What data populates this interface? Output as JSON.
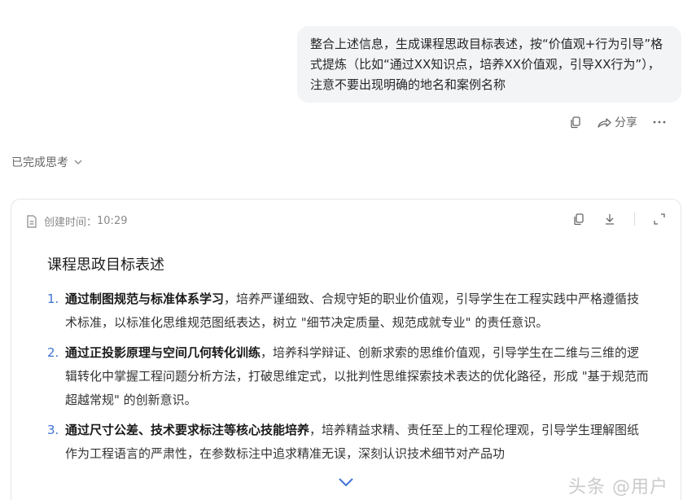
{
  "user_message": {
    "text": "整合上述信息，生成课程思政目标表述，按“价值观+行为引导”格式提炼（比如“通过XX知识点，培养XX价值观，引导XX行为”），注意不要出现明确的地名和案例名称"
  },
  "message_actions": {
    "copy_icon": "copy-icon",
    "share_label": "分享",
    "more_icon": "more-icon"
  },
  "thought": {
    "label": "已完成思考"
  },
  "document": {
    "created_label": "创建时间：",
    "created_time": "10:29",
    "title": "课程思政目标表述",
    "items": [
      {
        "num": "1.",
        "bold": "通过制图规范与标准体系学习",
        "text": "，培养严谨细致、合规守矩的职业价值观，引导学生在工程实践中严格遵循技术标准，以标准化思维规范图纸表达，树立 \"细节决定质量、规范成就专业\" 的责任意识。"
      },
      {
        "num": "2.",
        "bold": "通过正投影原理与空间几何转化训练",
        "text": "，培养科学辩证、创新求索的思维价值观，引导学生在二维与三维的逻辑转化中掌握工程问题分析方法，打破思维定式，以批判性思维探索技术表达的优化路径，形成 \"基于规范而超越常规\" 的创新意识。"
      },
      {
        "num": "3.",
        "bold": "通过尺寸公差、技术要求标注等核心技能培养",
        "text": "，培养精益求精、责任至上的工程伦理观，引导学生理解图纸作为工程语言的严肃性，在参数标注中追求精准无误，深刻认识技术细节对产品功"
      }
    ]
  },
  "watermark": "头条 @用户"
}
